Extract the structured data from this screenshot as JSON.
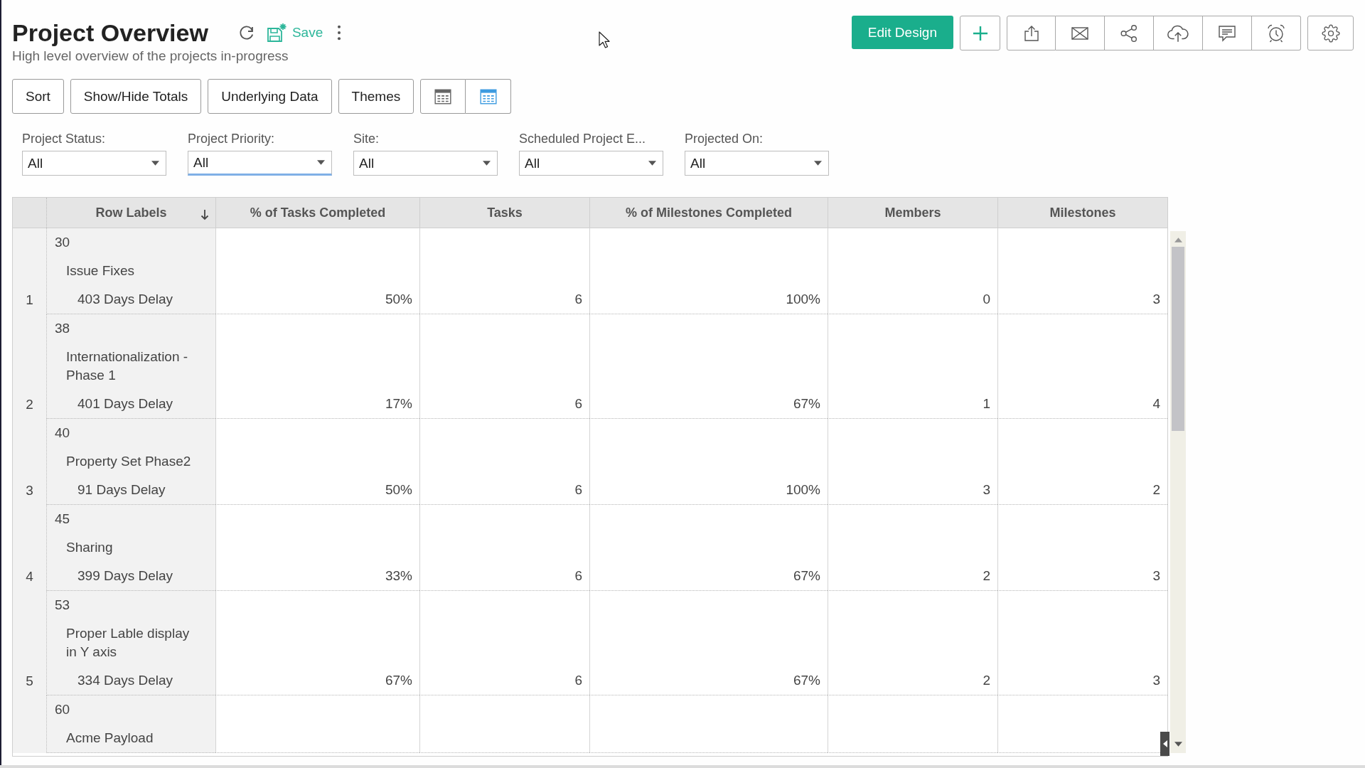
{
  "header": {
    "title": "Project Overview",
    "subtitle": "High level overview of the projects in-progress",
    "save_label": "Save"
  },
  "actions": {
    "primary_label": "Edit Design"
  },
  "toolbar": {
    "buttons": [
      "Sort",
      "Show/Hide Totals",
      "Underlying Data",
      "Themes"
    ],
    "views": [
      {
        "selected": false
      },
      {
        "selected": true
      }
    ]
  },
  "filters": [
    {
      "label": "Project Status:",
      "value": "All",
      "focused": false
    },
    {
      "label": "Project Priority:",
      "value": "All",
      "focused": true
    },
    {
      "label": "Site:",
      "value": "All",
      "focused": false
    },
    {
      "label": "Scheduled Project E...",
      "value": "All",
      "focused": false
    },
    {
      "label": "Projected On:",
      "value": "All",
      "focused": false
    }
  ],
  "table": {
    "columns": [
      {
        "label": "Row Labels",
        "sorted": true
      },
      {
        "label": "% of Tasks Completed",
        "sorted": false
      },
      {
        "label": "Tasks",
        "sorted": false
      },
      {
        "label": "% of Milestones Completed",
        "sorted": false
      },
      {
        "label": "Members",
        "sorted": false
      },
      {
        "label": "Milestones",
        "sorted": false
      }
    ],
    "rows": [
      {
        "number": "1",
        "id": "30",
        "name": "Issue Fixes",
        "delay": "403 Days Delay",
        "values": [
          "50%",
          "6",
          "100%",
          "0",
          "3"
        ]
      },
      {
        "number": "2",
        "id": "38",
        "name": "Internationalization - Phase 1",
        "delay": "401 Days Delay",
        "values": [
          "17%",
          "6",
          "67%",
          "1",
          "4"
        ]
      },
      {
        "number": "3",
        "id": "40",
        "name": "Property Set Phase2",
        "delay": "91 Days Delay",
        "values": [
          "50%",
          "6",
          "100%",
          "3",
          "2"
        ]
      },
      {
        "number": "4",
        "id": "45",
        "name": "Sharing",
        "delay": "399 Days Delay",
        "values": [
          "33%",
          "6",
          "67%",
          "2",
          "3"
        ]
      },
      {
        "number": "5",
        "id": "53",
        "name": "Proper Lable display in Y axis",
        "delay": "334 Days Delay",
        "values": [
          "67%",
          "6",
          "67%",
          "2",
          "3"
        ]
      },
      {
        "id": "60",
        "name": "Acme Payload"
      }
    ]
  }
}
